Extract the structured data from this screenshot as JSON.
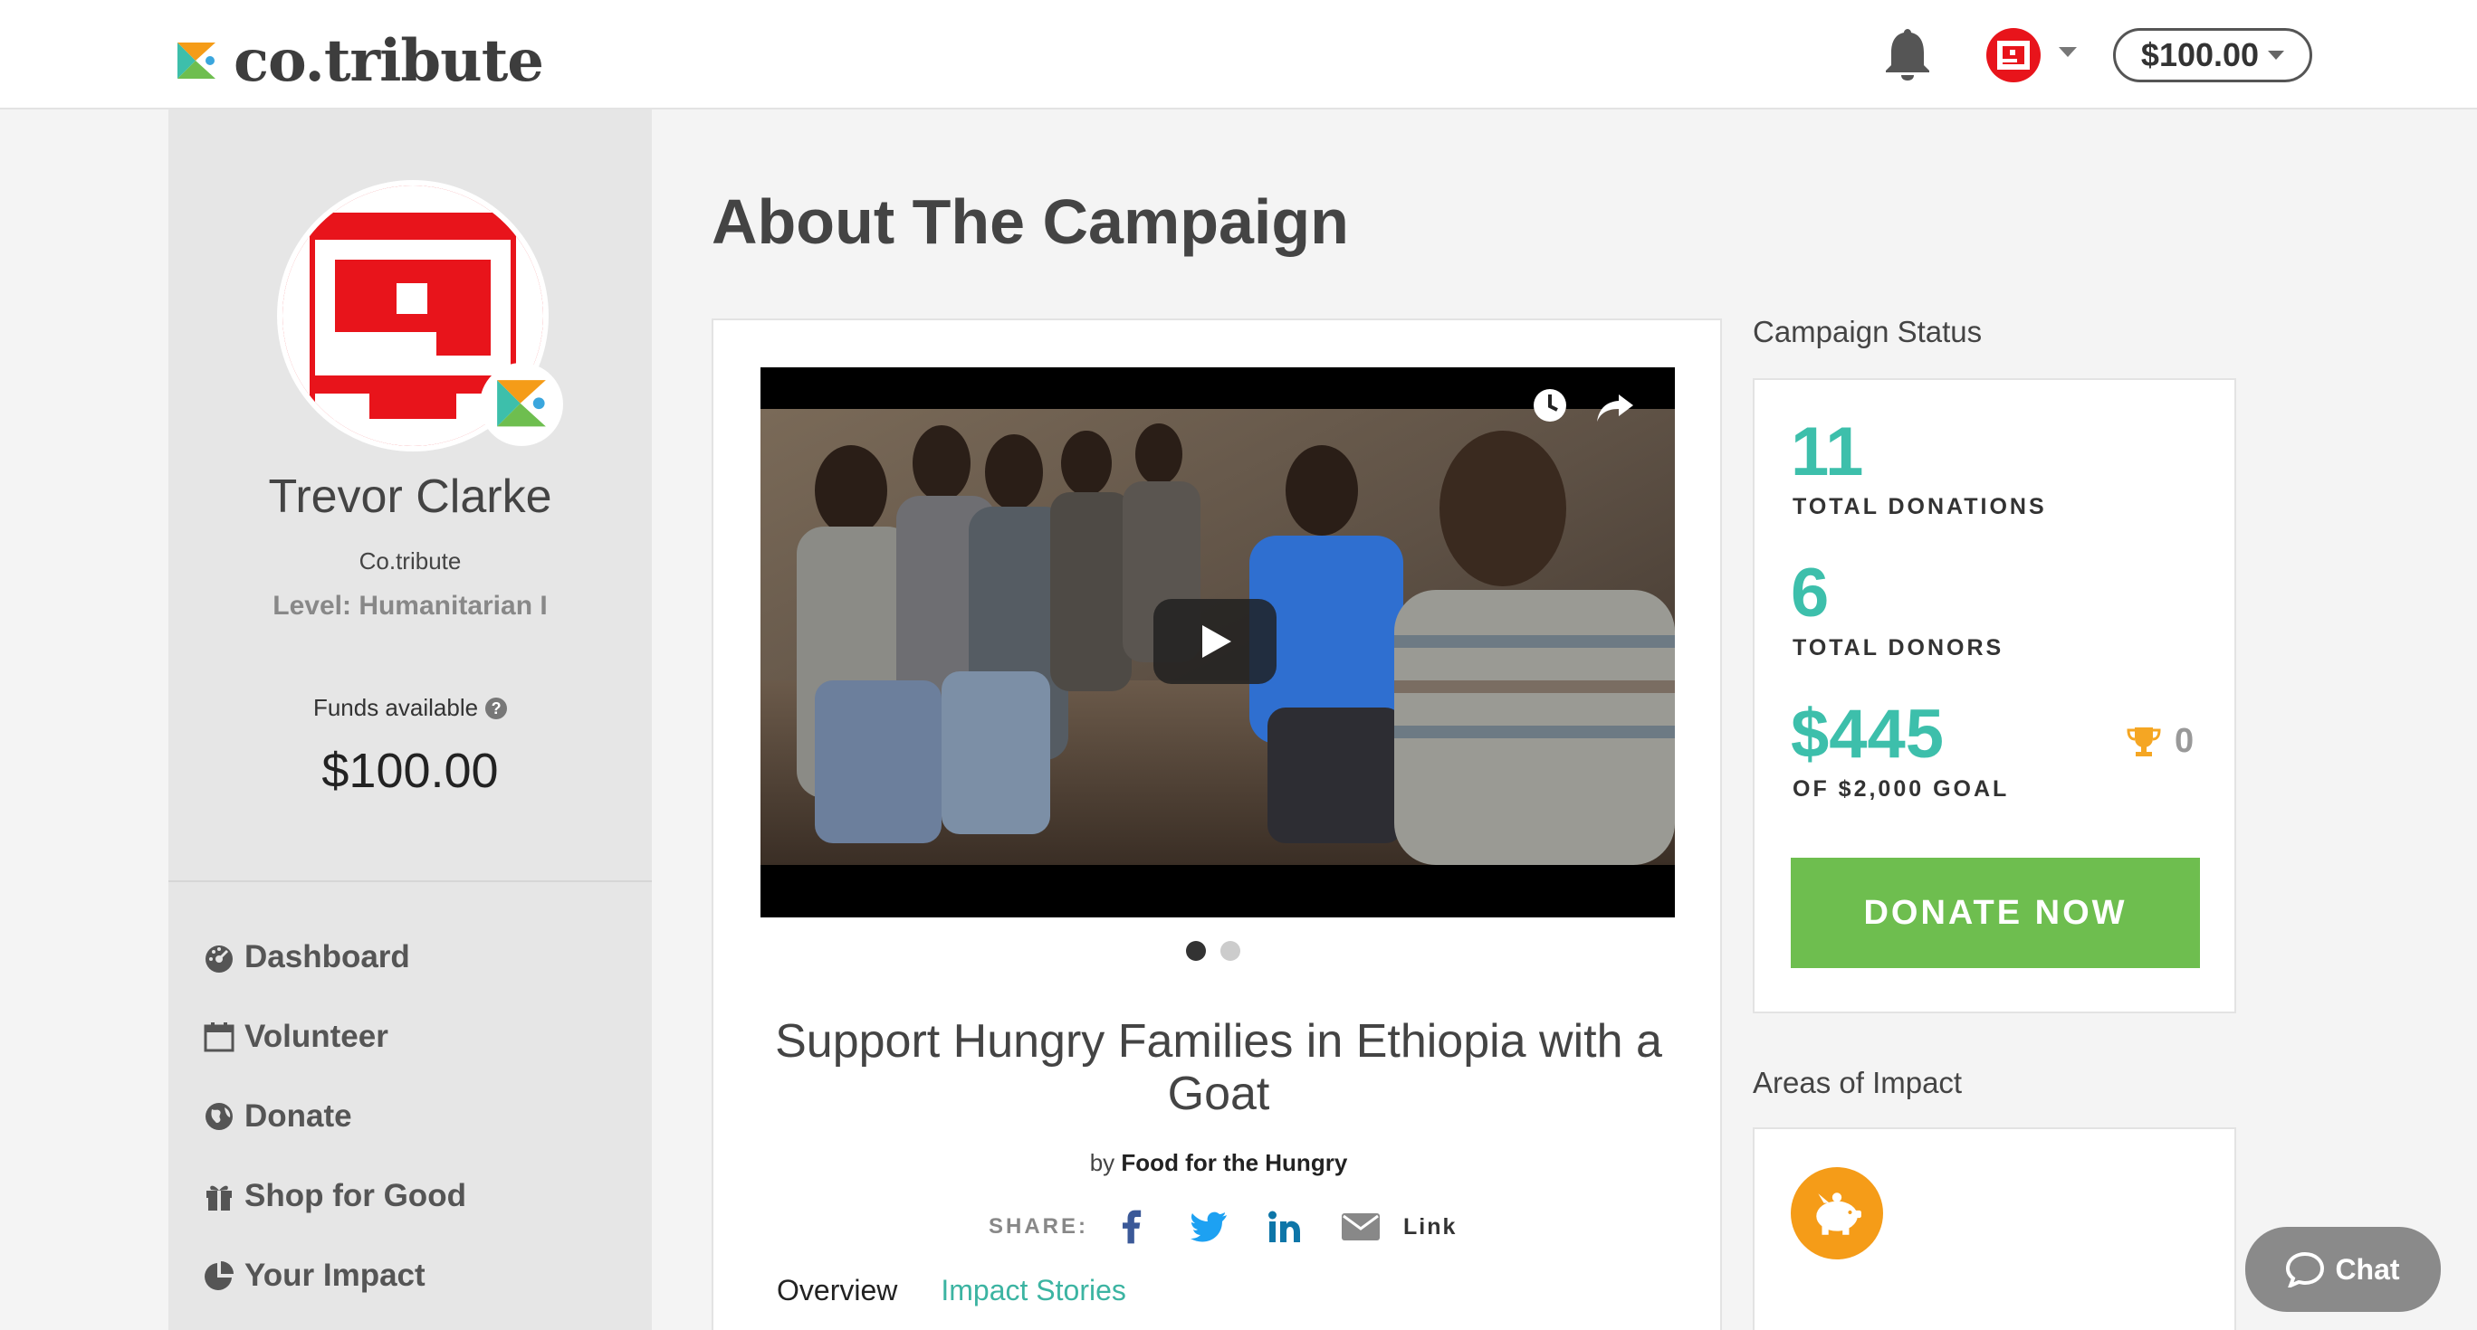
{
  "header": {
    "logo_text": "co.tribute",
    "balance": "$100.00"
  },
  "profile": {
    "name": "Trevor Clarke",
    "org": "Co.tribute",
    "level": "Level: Humanitarian I",
    "funds_label": "Funds available",
    "funds_amount": "$100.00"
  },
  "nav": [
    {
      "label": "Dashboard",
      "icon": "dashboard-icon"
    },
    {
      "label": "Volunteer",
      "icon": "calendar-icon"
    },
    {
      "label": "Donate",
      "icon": "globe-icon"
    },
    {
      "label": "Shop for Good",
      "icon": "gift-icon"
    },
    {
      "label": "Your Impact",
      "icon": "pie-chart-icon"
    }
  ],
  "main": {
    "page_title": "About The Campaign",
    "campaign_title": "Support Hungry Families in Ethiopia with a Goat",
    "byline_prefix": "by",
    "organization": "Food for the Hungry",
    "share_label": "SHARE:",
    "share_link": "Link",
    "tabs": [
      {
        "label": "Overview"
      },
      {
        "label": "Impact Stories"
      }
    ]
  },
  "status": {
    "heading": "Campaign Status",
    "total_donations": "11",
    "total_donations_label": "TOTAL DONATIONS",
    "total_donors": "6",
    "total_donors_label": "TOTAL DONORS",
    "raised": "$445",
    "goal_label": "OF $2,000 GOAL",
    "trophy_count": "0",
    "donate_label": "DONATE NOW"
  },
  "impact": {
    "heading": "Areas of Impact",
    "icon": "piggy-bank-icon"
  },
  "chat": {
    "label": "Chat"
  },
  "colors": {
    "accent_teal": "#3dbfab",
    "donate_green": "#6ebe4f",
    "impact_orange": "#f59c18",
    "avatar_red": "#e8141b"
  }
}
